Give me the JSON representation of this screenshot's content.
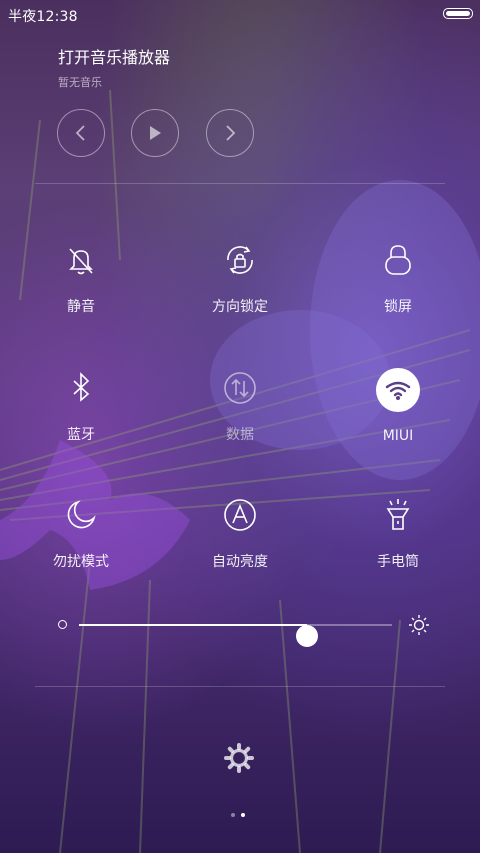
{
  "status_bar": {
    "time": "半夜12:38",
    "battery_level": 1.0
  },
  "music": {
    "title": "打开音乐播放器",
    "subtitle": "暂无音乐"
  },
  "media_controls": {
    "prev_icon": "chevron-left-icon",
    "play_icon": "play-icon",
    "next_icon": "chevron-right-icon"
  },
  "toggles": [
    {
      "label": "静音",
      "icon": "bell-off-icon",
      "active": false
    },
    {
      "label": "方向锁定",
      "icon": "rotation-lock-icon",
      "active": false
    },
    {
      "label": "锁屏",
      "icon": "lock-icon",
      "active": false
    },
    {
      "label": "蓝牙",
      "icon": "bluetooth-icon",
      "active": false
    },
    {
      "label": "数据",
      "icon": "data-icon",
      "active": false,
      "disabled": true
    },
    {
      "label": "MIUI",
      "icon": "wifi-icon",
      "active": true
    },
    {
      "label": "勿扰模式",
      "icon": "moon-icon",
      "active": false
    },
    {
      "label": "自动亮度",
      "icon": "auto-brightness-icon",
      "active": false
    },
    {
      "label": "手电筒",
      "icon": "flashlight-icon",
      "active": false
    }
  ],
  "brightness": {
    "level": 0.73
  },
  "settings_icon": "gear-icon",
  "pager": {
    "count": 2,
    "current": 2
  }
}
